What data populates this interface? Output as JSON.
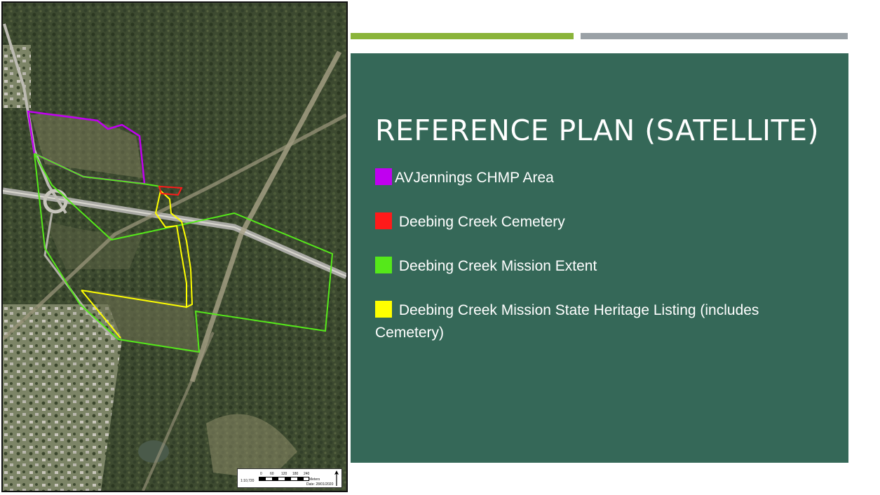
{
  "slide": {
    "title": "REFERENCE PLAN (SATELLITE)",
    "legend": [
      {
        "label": "AVJennings CHMP Area",
        "color": "#c000f0"
      },
      {
        "label": "Deebing Creek Cemetery",
        "color": "#ff1a1a"
      },
      {
        "label": "Deebing Creek Mission Extent",
        "color": "#55e81a"
      },
      {
        "label": "Deebing Creek Mission State Heritage Listing (includes Cemetery)",
        "color": "#ffff00"
      }
    ],
    "accent_green": "#8ab43a",
    "accent_gray": "#9aa1a6",
    "panel_color": "#356858"
  },
  "map": {
    "scale_ratio": "1:10,720",
    "scale_ticks": [
      "0",
      "60",
      "120",
      "180",
      "240"
    ],
    "scale_unit": "Meters",
    "date": "Date: 28/01/2020"
  }
}
